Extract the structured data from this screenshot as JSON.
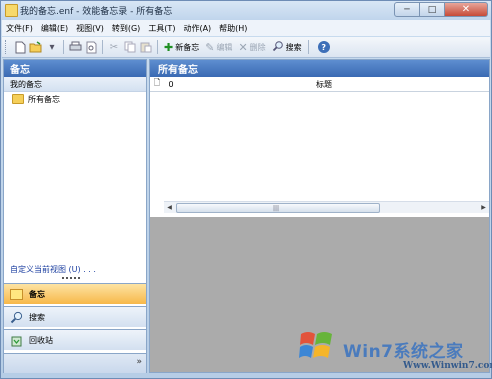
{
  "window": {
    "title": "我的备忘.enf - 效能备忘录 - 所有备忘",
    "min_label": "─",
    "max_label": "□",
    "close_label": "✕"
  },
  "menu": [
    "文件(F)",
    "编辑(E)",
    "视图(V)",
    "转到(G)",
    "工具(T)",
    "动作(A)",
    "帮助(H)"
  ],
  "toolbar": {
    "new_memo": "新备忘",
    "edit": "编辑",
    "delete": "删除",
    "search": "搜索",
    "help_glyph": "?"
  },
  "nav": {
    "header": "备忘",
    "group": "我的备忘",
    "folder": "所有备忘",
    "customize": "自定义当前视图 (U) . . .",
    "buttons": [
      {
        "label": "备忘",
        "icon": "memo-icon",
        "active": true
      },
      {
        "label": "搜索",
        "icon": "search-icon",
        "active": false
      },
      {
        "label": "回收站",
        "icon": "recycle-bin-icon",
        "active": false
      }
    ]
  },
  "content": {
    "header": "所有备忘",
    "columns": {
      "icon": "🗋",
      "attach": "0",
      "title": "标题"
    },
    "scroll_grip": "|||"
  },
  "watermark": {
    "text": "Win7系统之家",
    "url": "Www.Winwin7.com"
  }
}
